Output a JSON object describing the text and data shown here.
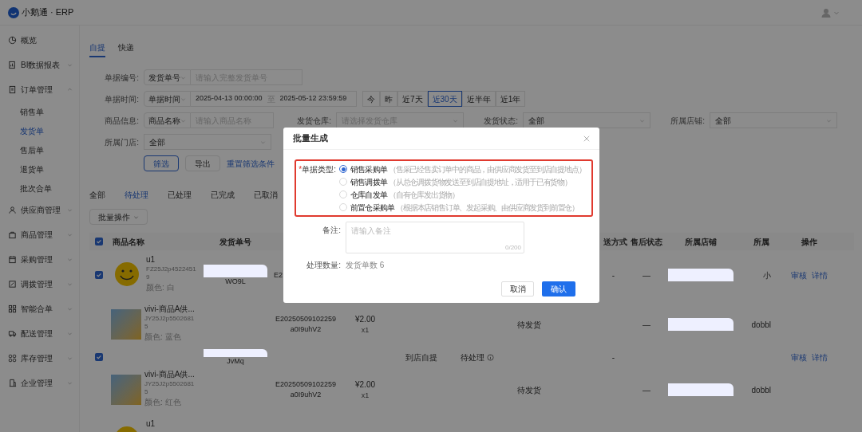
{
  "header": {
    "logo_text": "小鹅通 · ERP"
  },
  "sidebar": {
    "items": [
      {
        "label": "概览",
        "kind": "link"
      },
      {
        "label": "BI数据报表",
        "kind": "group",
        "expanded": false
      },
      {
        "label": "订单管理",
        "kind": "group",
        "expanded": true,
        "children": [
          {
            "label": "销售单",
            "selected": false
          },
          {
            "label": "发货单",
            "selected": true
          },
          {
            "label": "售后单",
            "selected": false
          },
          {
            "label": "退货单",
            "selected": false
          },
          {
            "label": "批次合单",
            "selected": false
          }
        ]
      },
      {
        "label": "供应商管理",
        "kind": "group",
        "expanded": false
      },
      {
        "label": "商品管理",
        "kind": "group",
        "expanded": false
      },
      {
        "label": "采购管理",
        "kind": "group",
        "expanded": false
      },
      {
        "label": "调拨管理",
        "kind": "group",
        "expanded": false
      },
      {
        "label": "智能合单",
        "kind": "group",
        "expanded": false
      },
      {
        "label": "配送管理",
        "kind": "group",
        "expanded": false
      },
      {
        "label": "库存管理",
        "kind": "group",
        "expanded": false
      },
      {
        "label": "企业管理",
        "kind": "group",
        "expanded": false
      }
    ]
  },
  "mode_tabs": [
    {
      "label": "自提",
      "selected": true
    },
    {
      "label": "快递",
      "selected": false
    }
  ],
  "filters": {
    "rows": [
      [
        {
          "kind": "select_input",
          "label": "单据编号:",
          "select": "发货单号",
          "placeholder": "请输入完整发货单号"
        }
      ],
      [
        {
          "kind": "date_range",
          "label": "单据时间:",
          "select": "单据时间",
          "start": "2025-04-13 00:00:00",
          "separator": "至",
          "end": "2025-05-12 23:59:59",
          "quick": [
            {
              "label": "今",
              "selected": false
            },
            {
              "label": "昨",
              "selected": false
            },
            {
              "label": "近7天",
              "selected": false
            },
            {
              "label": "近30天",
              "selected": true
            },
            {
              "label": "近半年",
              "selected": false
            },
            {
              "label": "近1年",
              "selected": false
            }
          ]
        }
      ],
      [
        {
          "kind": "select_input",
          "label": "商品信息:",
          "select": "商品名称",
          "placeholder": "请输入商品名称"
        },
        {
          "kind": "dropdown",
          "label": "发货仓库:",
          "placeholder": "请选择发货仓库"
        },
        {
          "kind": "dropdown",
          "label": "发货状态:",
          "value": "全部"
        },
        {
          "kind": "dropdown",
          "label": "所属店铺:",
          "value": "全部"
        }
      ],
      [
        {
          "kind": "dropdown",
          "label": "所属门店:",
          "value": "全部"
        }
      ]
    ],
    "buttons": [
      {
        "label": "筛选",
        "kind": "outline"
      },
      {
        "label": "导出",
        "kind": "plain"
      },
      {
        "label": "重置筛选条件",
        "kind": "link"
      }
    ]
  },
  "status_tabs": [
    {
      "label": "全部",
      "selected": false
    },
    {
      "label": "待处理",
      "selected": true
    },
    {
      "label": "已处理",
      "selected": false
    },
    {
      "label": "已完成",
      "selected": false
    },
    {
      "label": "已取消",
      "selected": false
    }
  ],
  "batch_button": {
    "label": "批量操作"
  },
  "table": {
    "header_checked": true,
    "columns": [
      {
        "kind": "product",
        "label": "商品名称"
      },
      {
        "kind": "shipment",
        "label": "发货单号"
      },
      {
        "kind": "delivery",
        "label": "送方式"
      },
      {
        "kind": "aftersale",
        "label": "售后状态"
      },
      {
        "kind": "store",
        "label": "所属店铺"
      },
      {
        "kind": "store2",
        "label": "所属"
      },
      {
        "kind": "actions",
        "label": "操作"
      }
    ],
    "rows": [
      {
        "checked": true,
        "product": {
          "kind": "smiley",
          "name": "u1",
          "code": "FZ25J2p45224519",
          "spec": "颜色: 白"
        },
        "shipment": "WO9L",
        "ecode": "E2",
        "delivery": "-",
        "aftersale": "—",
        "store_redacted": true,
        "store2": "小",
        "actions": [
          "审核",
          "详情"
        ]
      },
      {
        "product": {
          "kind": "photo",
          "name": "vivi-商品A供...",
          "code": "JY25J2p55026815",
          "spec": "颜色: 蓝色"
        },
        "ecode": "E20250509102259a0I9uhV2",
        "price": "¥2.00",
        "qty": "x1",
        "ship_status": "待发货",
        "aftersale": "—",
        "store_redacted": true,
        "store2": "dobbl"
      },
      {
        "checked": true,
        "shipment": "JvMq",
        "pickup": "到店自提",
        "status": "待处理",
        "delivery": "-",
        "actions": [
          "审核",
          "详情"
        ]
      },
      {
        "product": {
          "kind": "photo",
          "name": "vivi-商品A供...",
          "code": "JY25J2p55026815",
          "spec": "颜色: 红色"
        },
        "ecode": "E20250509102259a0I9uhV2",
        "price": "¥2.00",
        "qty": "x1",
        "ship_status": "待发货",
        "aftersale": "—",
        "store_redacted": true,
        "store2": "dobbl"
      },
      {
        "product": {
          "kind": "smiley",
          "name": "u1"
        }
      }
    ]
  },
  "dialog": {
    "title": "批量生成",
    "type_field": {
      "required_mark": "*",
      "label": "单据类型:",
      "options": [
        {
          "label": "销售采购单",
          "description": "（售采已经售卖订单中的商品，由供应商发货至到店自提地点）",
          "selected": true
        },
        {
          "label": "销售调拨单",
          "description": "（从总仓调拨货物发送至到店自提地址，适用于已有货物）",
          "selected": false
        },
        {
          "label": "仓库自发单",
          "description": "（自有仓库发出货物）",
          "selected": false
        },
        {
          "label": "前置仓采购单",
          "description": "（根据本店销售订单、发起采购、由供应商发货到前置仓）",
          "selected": false
        }
      ]
    },
    "remark": {
      "label": "备注:",
      "placeholder": "请输入备注",
      "counter": "0/200"
    },
    "count": {
      "label": "处理数量:",
      "value": "发货单数 6"
    },
    "buttons": [
      {
        "label": "取消",
        "kind": "secondary"
      },
      {
        "label": "确认",
        "kind": "primary"
      }
    ]
  }
}
